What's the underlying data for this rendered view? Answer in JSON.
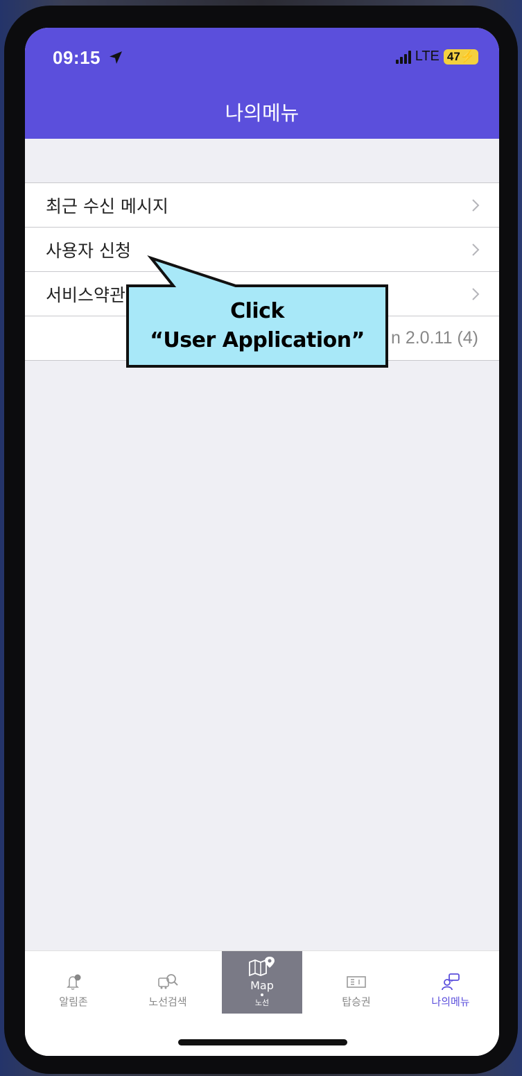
{
  "status_bar": {
    "time": "09:15",
    "network": "LTE",
    "battery": "47"
  },
  "header": {
    "title": "나의메뉴"
  },
  "menu": {
    "items": [
      {
        "label": "최근 수신 메시지"
      },
      {
        "label": "사용자 신청"
      },
      {
        "label": "서비스약관"
      }
    ],
    "version": "n 2.0.11 (4)"
  },
  "tabbar": {
    "tabs": [
      {
        "label": "알림존",
        "icon": "bell-icon"
      },
      {
        "label": "노선검색",
        "icon": "bus-search-icon"
      },
      {
        "label": "노선",
        "main": "Map",
        "icon": "map-pin-icon"
      },
      {
        "label": "탑승권",
        "icon": "ticket-icon"
      },
      {
        "label": "나의메뉴",
        "icon": "person-chat-icon"
      }
    ],
    "active_color": "#5b4fdc"
  },
  "annotation": {
    "line1": "Click",
    "line2": "“User Application”",
    "fill": "#a8e8f8"
  },
  "colors": {
    "header": "#5b4fdc",
    "background": "#efeff4"
  }
}
